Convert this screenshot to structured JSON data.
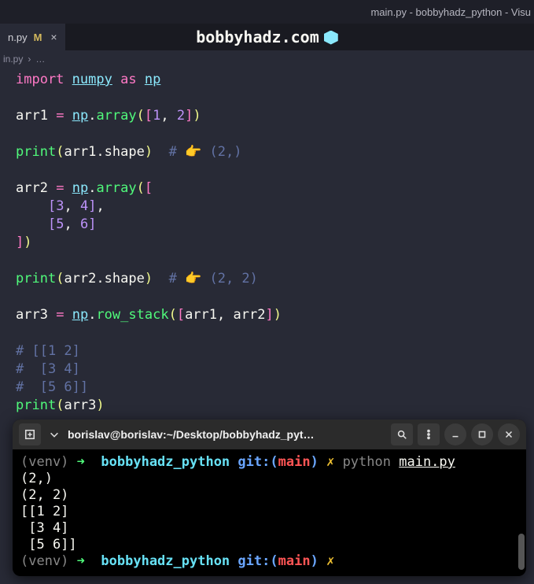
{
  "titleBar": "main.py - bobbyhadz_python - Visu",
  "tab": {
    "label": "n.py",
    "modified": "M",
    "close": "×"
  },
  "overlay": {
    "text": "bobbyhadz.com"
  },
  "breadcrumb": {
    "file": "in.py",
    "sep": "›",
    "dots": "…"
  },
  "code": {
    "l1_import": "import",
    "l1_numpy": "numpy",
    "l1_as": "as",
    "l1_np": "np",
    "arr1": "arr1",
    "eq": "=",
    "np": "np",
    "dot": ".",
    "array": "array",
    "open": "(",
    "close": ")",
    "lbr": "[",
    "rbr": "]",
    "comma": ",",
    "n1": "1",
    "n2": "2",
    "n3": "3",
    "n4": "4",
    "n5": "5",
    "n6": "6",
    "print": "print",
    "shape": "shape",
    "hash": "#",
    "hand": "👉",
    "c_2": "(2,)",
    "arr2": "arr2",
    "c_22": "(2, 2)",
    "arr3": "arr3",
    "row_stack": "row_stack",
    "cmt1": "# [[1 2]",
    "cmt2": "#  [3 4]",
    "cmt3": "#  [5 6]]"
  },
  "terminal": {
    "header": "borislav@borislav:~/Desktop/bobbyhadz_pyt…",
    "prompt": {
      "venv": "(venv)",
      "arrow": "➜",
      "dir": "bobbyhadz_python",
      "git": "git:(",
      "branch": "main",
      "gitc": ")",
      "x": "✗",
      "cmd": "python",
      "file": "main.py"
    },
    "out1": "(2,)",
    "out2": "(2, 2)",
    "out3": "[[1 2]",
    "out4": " [3 4]",
    "out5": " [5 6]]"
  }
}
